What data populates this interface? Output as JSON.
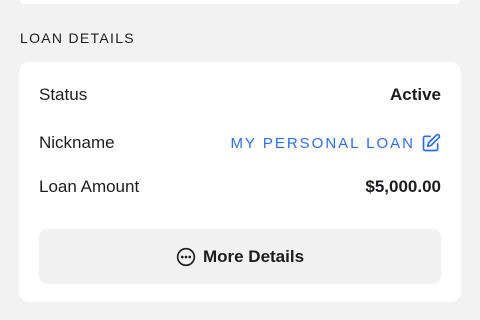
{
  "section": {
    "title": "LOAN DETAILS"
  },
  "details": {
    "status_label": "Status",
    "status_value": "Active",
    "nickname_label": "Nickname",
    "nickname_value": "MY PERSONAL LOAN",
    "amount_label": "Loan Amount",
    "amount_value": "$5,000.00"
  },
  "actions": {
    "more_details_label": "More Details"
  },
  "icons": {
    "edit": "edit-pencil-icon",
    "more": "more-horizontal-icon"
  },
  "colors": {
    "accent": "#2f6ee0",
    "text": "#1d1d1f",
    "background": "#f2f2f2",
    "card": "#ffffff",
    "button": "#f1f1f1"
  }
}
